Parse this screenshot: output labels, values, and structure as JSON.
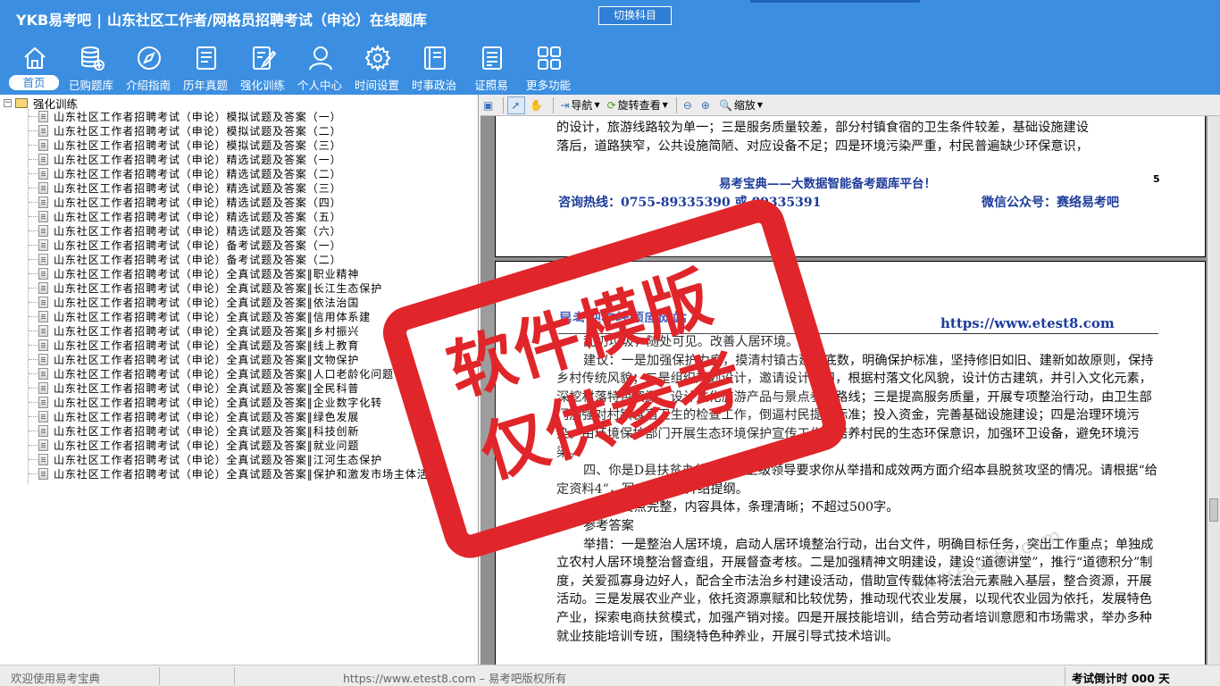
{
  "header": {
    "logo": "YKB易考吧",
    "title": "山东社区工作者/网格员招聘考试（申论）在线题库",
    "switch_label": "切换科目"
  },
  "nav": [
    {
      "label": "首页",
      "icon": "home-icon"
    },
    {
      "label": "已购题库",
      "icon": "database-icon"
    },
    {
      "label": "介绍指南",
      "icon": "compass-icon"
    },
    {
      "label": "历年真题",
      "icon": "list-document-icon"
    },
    {
      "label": "强化训练",
      "icon": "edit-document-icon"
    },
    {
      "label": "个人中心",
      "icon": "user-icon"
    },
    {
      "label": "时间设置",
      "icon": "gear-icon"
    },
    {
      "label": "时事政治",
      "icon": "book-icon"
    },
    {
      "label": "证照易",
      "icon": "certificate-icon"
    },
    {
      "label": "更多功能",
      "icon": "grid-icon"
    }
  ],
  "tree": {
    "root_label": "强化训练",
    "expander": "−",
    "items": [
      "山东社区工作者招聘考试（申论）模拟试题及答案（一）",
      "山东社区工作者招聘考试（申论）模拟试题及答案（二）",
      "山东社区工作者招聘考试（申论）模拟试题及答案（三）",
      "山东社区工作者招聘考试（申论）精选试题及答案（一）",
      "山东社区工作者招聘考试（申论）精选试题及答案（二）",
      "山东社区工作者招聘考试（申论）精选试题及答案（三）",
      "山东社区工作者招聘考试（申论）精选试题及答案（四）",
      "山东社区工作者招聘考试（申论）精选试题及答案（五）",
      "山东社区工作者招聘考试（申论）精选试题及答案（六）",
      "山东社区工作者招聘考试（申论）备考试题及答案（一）",
      "山东社区工作者招聘考试（申论）备考试题及答案（二）",
      "山东社区工作者招聘考试（申论）全真试题及答案‖职业精神",
      "山东社区工作者招聘考试（申论）全真试题及答案‖长江生态保护",
      "山东社区工作者招聘考试（申论）全真试题及答案‖依法治国",
      "山东社区工作者招聘考试（申论）全真试题及答案‖信用体系建",
      "山东社区工作者招聘考试（申论）全真试题及答案‖乡村振兴",
      "山东社区工作者招聘考试（申论）全真试题及答案‖线上教育",
      "山东社区工作者招聘考试（申论）全真试题及答案‖文物保护",
      "山东社区工作者招聘考试（申论）全真试题及答案‖人口老龄化问题",
      "山东社区工作者招聘考试（申论）全真试题及答案‖全民科普",
      "山东社区工作者招聘考试（申论）全真试题及答案‖企业数字化转",
      "山东社区工作者招聘考试（申论）全真试题及答案‖绿色发展",
      "山东社区工作者招聘考试（申论）全真试题及答案‖科技创新",
      "山东社区工作者招聘考试（申论）全真试题及答案‖就业问题",
      "山东社区工作者招聘考试（申论）全真试题及答案‖江河生态保护",
      "山东社区工作者招聘考试（申论）全真试题及答案‖保护和激发市场主体活力"
    ]
  },
  "toolbar": {
    "navigate": "导航",
    "rotate_view": "旋转查看",
    "zoom": "缩放"
  },
  "page1": {
    "lines": [
      "的设计，旅游线路较为单一；三是服务质量较差，部分村镇食宿的卫生条件较差，基础设施建设",
      "落后，道路狭窄，公共设施简陋、对应设备不足；四是环境污染严重，村民普遍缺少环保意识，"
    ],
    "slogan": "易考宝典——大数据智能备考题库平台！",
    "page_number": "5",
    "hotline": "咨询热线：0755-89335390 或 89335391",
    "wechat": "微信公众号：赛络易考吧"
  },
  "page2": {
    "header_left": "易考吧在线题库网站",
    "url": "https://www.etest8.com",
    "paragraphs": [
      {
        "indent": true,
        "text": "乱扔垃圾，随处可见。改善人居环境。"
      },
      {
        "indent": true,
        "text": "建议：一是加强保护力度，摸清村镇古建筑底数，明确保护标准，坚持修旧如旧、建新如故原则，保持乡村传统风貌；二是组织规划设计，邀请设计公司，根据村落文化风貌，设计仿古建筑，并引入文化元素，深挖村落特色资源，设计文化旅游产品与景点参观路线；三是提高服务质量，开展专项整治行动，由卫生部门加强对村镇食宿卫生的检查工作，倒逼村民提高标准；投入资金，完善基础设施建设；四是治理环境污染，由环境保护部门开展生态环境保护宣传工作，培养村民的生态环保意识，加强环卫设备，避免环境污染。"
      },
      {
        "indent": true,
        "text": "四、你是D县扶贫办的成员，上级领导要求你从举措和成效两方面介绍本县脱贫攻坚的情况。请根据“给定资料4”，写一份情况介绍提纲。"
      },
      {
        "indent": true,
        "text": "要求：要点完整，内容具体，条理清晰；不超过500字。"
      },
      {
        "indent": true,
        "text": "参考答案"
      },
      {
        "indent": true,
        "text": "举措：一是整治人居环境，启动人居环境整治行动，出台文件，明确目标任务，突出工作重点；单独成立农村人居环境整治督查组，开展督查考核。二是加强精神文明建设，建设“道德讲堂”，推行“道德积分”制度，关爱孤寡身边好人，配合全市法治乡村建设活动，借助宣传载体将法治元素融入基层，整合资源，开展活动。三是发展农业产业，依托资源禀赋和比较优势，推动现代农业发展，以现代农业园为依托，发展特色产业，探索电商扶贫模式，加强产销对接。四是开展技能培训，结合劳动者培训意愿和市场需求，举办多种就业技能培训专班，围绕特色种养业，开展引导式技术培训。"
      }
    ]
  },
  "watermark_url": "www.etest8.com",
  "stamp": {
    "line1": "软件模版",
    "line2": "仅供参考",
    "color": "#e0262a"
  },
  "status": {
    "left": "欢迎使用易考宝典",
    "center": "https://www.etest8.com – 易考吧版权所有",
    "right": "考试倒计时 000 天"
  },
  "colors": {
    "header_bg": "#3c8fe0",
    "accent_text": "#1d3c9b"
  }
}
